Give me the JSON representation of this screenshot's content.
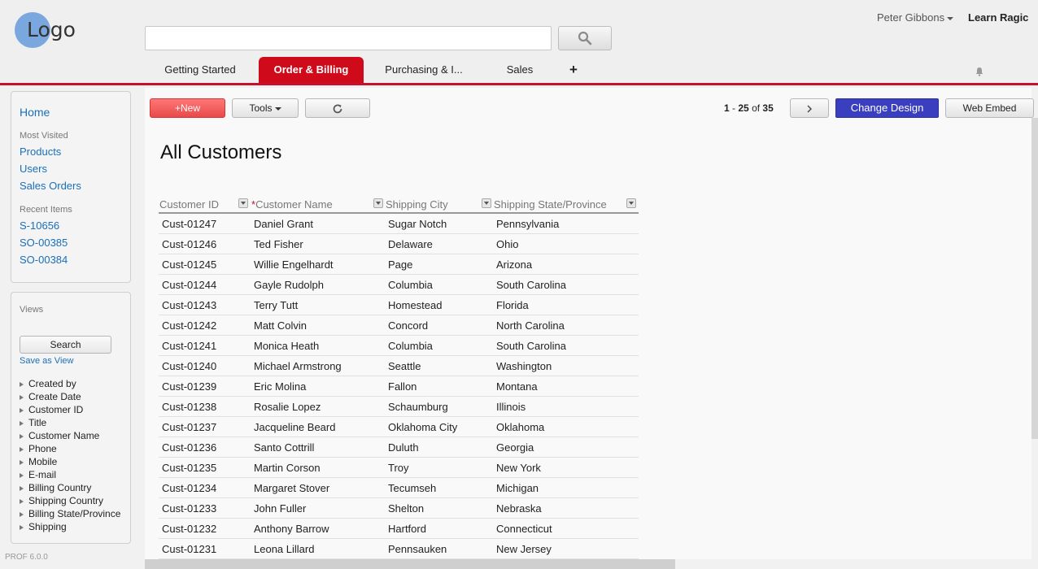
{
  "header": {
    "logo_text": "Logo",
    "search_placeholder": "",
    "user_name": "Peter Gibbons",
    "learn_link": "Learn Ragic",
    "tabs": [
      {
        "label": "Getting Started"
      },
      {
        "label": "Order & Billing"
      },
      {
        "label": "Purchasing & I..."
      },
      {
        "label": "Sales"
      },
      {
        "label": "+"
      }
    ]
  },
  "sidebar": {
    "home": "Home",
    "most_visited_label": "Most Visited",
    "most_visited": [
      "Products",
      "Users",
      "Sales Orders"
    ],
    "recent_label": "Recent Items",
    "recent": [
      "S-10656",
      "SO-00385",
      "SO-00384"
    ],
    "views_label": "Views",
    "search_btn": "Search",
    "save_view": "Save as View",
    "fields": [
      "Created by",
      "Create Date",
      "Customer ID",
      "Title",
      "Customer Name",
      "Phone",
      "Mobile",
      "E-mail",
      "Billing Country",
      "Shipping Country",
      "Billing State/Province",
      "Shipping"
    ],
    "version": "PROF 6.0.0"
  },
  "toolbar": {
    "new_label": "+New",
    "tools_label": "Tools",
    "pager": {
      "start": "1",
      "end": "25",
      "of_word": "of",
      "total": "35"
    },
    "change_design": "Change Design",
    "web_embed": "Web Embed"
  },
  "page": {
    "title": "All Customers"
  },
  "table": {
    "columns": [
      "Customer ID",
      "Customer Name",
      "Shipping City",
      "Shipping State/Province"
    ],
    "rows": [
      [
        "Cust-01247",
        "Daniel Grant",
        "Sugar Notch",
        "Pennsylvania"
      ],
      [
        "Cust-01246",
        "Ted Fisher",
        "Delaware",
        "Ohio"
      ],
      [
        "Cust-01245",
        "Willie Engelhardt",
        "Page",
        "Arizona"
      ],
      [
        "Cust-01244",
        "Gayle Rudolph",
        "Columbia",
        "South Carolina"
      ],
      [
        "Cust-01243",
        "Terry Tutt",
        "Homestead",
        "Florida"
      ],
      [
        "Cust-01242",
        "Matt Colvin",
        "Concord",
        "North Carolina"
      ],
      [
        "Cust-01241",
        "Monica Heath",
        "Columbia",
        "South Carolina"
      ],
      [
        "Cust-01240",
        "Michael Armstrong",
        "Seattle",
        "Washington"
      ],
      [
        "Cust-01239",
        "Eric Molina",
        "Fallon",
        "Montana"
      ],
      [
        "Cust-01238",
        "Rosalie Lopez",
        "Schaumburg",
        "Illinois"
      ],
      [
        "Cust-01237",
        "Jacqueline Beard",
        "Oklahoma City",
        "Oklahoma"
      ],
      [
        "Cust-01236",
        "Santo Cottrill",
        "Duluth",
        "Georgia"
      ],
      [
        "Cust-01235",
        "Martin Corson",
        "Troy",
        "New York"
      ],
      [
        "Cust-01234",
        "Margaret Stover",
        "Tecumseh",
        "Michigan"
      ],
      [
        "Cust-01233",
        "John Fuller",
        "Shelton",
        "Nebraska"
      ],
      [
        "Cust-01232",
        "Anthony Barrow",
        "Hartford",
        "Connecticut"
      ],
      [
        "Cust-01231",
        "Leona Lillard",
        "Pennsauken",
        "New Jersey"
      ]
    ]
  },
  "colors": {
    "accent": "#cf0a1b",
    "link": "#1a6fb8",
    "design_button": "#3a3fbf"
  }
}
